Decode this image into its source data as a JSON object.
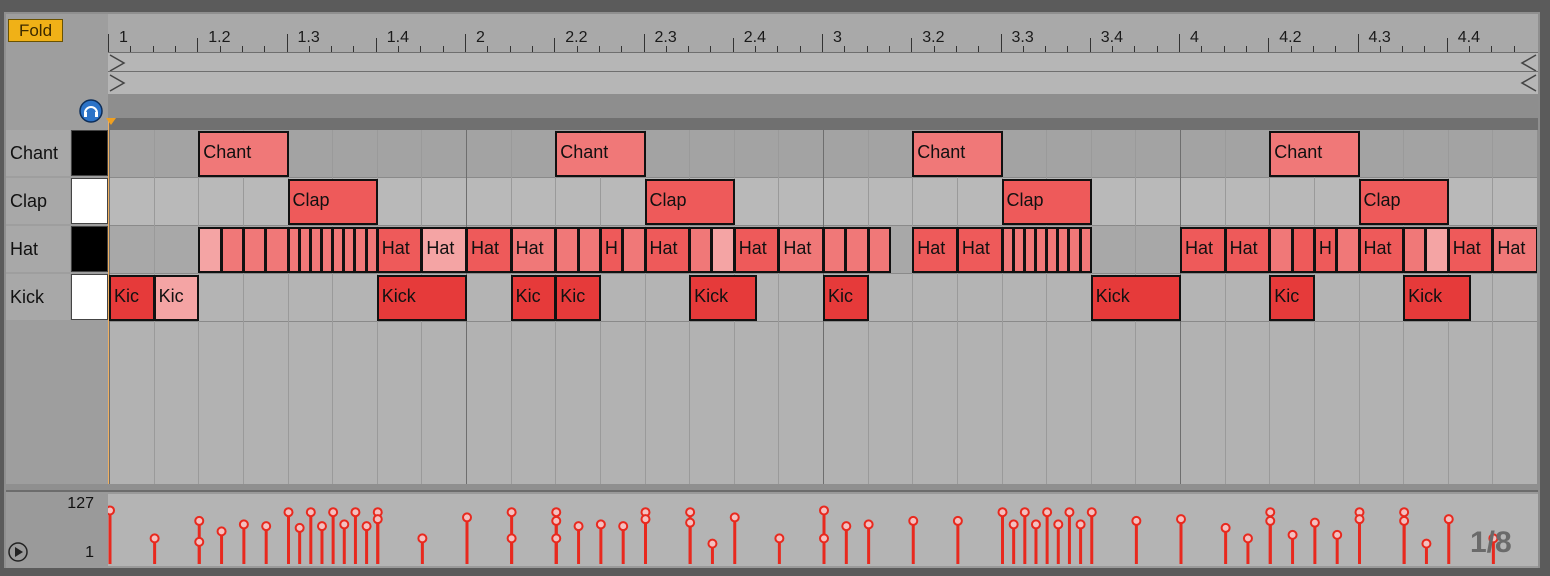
{
  "fold_label": "Fold",
  "ruler": {
    "labels": [
      "1",
      "1.2",
      "1.3",
      "1.4",
      "2",
      "2.2",
      "2.3",
      "2.4",
      "3",
      "3.2",
      "3.3",
      "3.4",
      "4",
      "4.2",
      "4.3",
      "4.4"
    ]
  },
  "lanes": [
    {
      "name": "Chant",
      "key": "black"
    },
    {
      "name": "Clap",
      "key": "white"
    },
    {
      "name": "Hat",
      "key": "black"
    },
    {
      "name": "Kick",
      "key": "white"
    }
  ],
  "notes": [
    {
      "lane": 0,
      "start": 0.5,
      "len": 0.5,
      "label": "Chant",
      "shade": "light"
    },
    {
      "lane": 0,
      "start": 2.5,
      "len": 0.5,
      "label": "Chant",
      "shade": "light"
    },
    {
      "lane": 0,
      "start": 4.5,
      "len": 0.5,
      "label": "Chant",
      "shade": "light"
    },
    {
      "lane": 0,
      "start": 6.5,
      "len": 0.5,
      "label": "Chant",
      "shade": "light"
    },
    {
      "lane": 1,
      "start": 1.0,
      "len": 0.5,
      "label": "Clap",
      "shade": "strong"
    },
    {
      "lane": 1,
      "start": 3.0,
      "len": 0.5,
      "label": "Clap",
      "shade": "strong"
    },
    {
      "lane": 1,
      "start": 5.0,
      "len": 0.5,
      "label": "Clap",
      "shade": "strong"
    },
    {
      "lane": 1,
      "start": 7.0,
      "len": 0.5,
      "label": "Clap",
      "shade": "strong"
    },
    {
      "lane": 2,
      "start": 0.5,
      "len": 0.125,
      "label": "",
      "shade": "pale"
    },
    {
      "lane": 2,
      "start": 0.625,
      "len": 0.125,
      "label": "",
      "shade": "light"
    },
    {
      "lane": 2,
      "start": 0.75,
      "len": 0.125,
      "label": "",
      "shade": "light"
    },
    {
      "lane": 2,
      "start": 0.875,
      "len": 0.125,
      "label": "",
      "shade": "light"
    },
    {
      "lane": 2,
      "start": 1.0,
      "len": 0.0625,
      "label": "",
      "shade": "light"
    },
    {
      "lane": 2,
      "start": 1.0625,
      "len": 0.0625,
      "label": "",
      "shade": "light"
    },
    {
      "lane": 2,
      "start": 1.125,
      "len": 0.0625,
      "label": "",
      "shade": "light"
    },
    {
      "lane": 2,
      "start": 1.1875,
      "len": 0.0625,
      "label": "",
      "shade": "light"
    },
    {
      "lane": 2,
      "start": 1.25,
      "len": 0.0625,
      "label": "",
      "shade": "light"
    },
    {
      "lane": 2,
      "start": 1.3125,
      "len": 0.0625,
      "label": "",
      "shade": "light"
    },
    {
      "lane": 2,
      "start": 1.375,
      "len": 0.0625,
      "label": "",
      "shade": "light"
    },
    {
      "lane": 2,
      "start": 1.4375,
      "len": 0.0625,
      "label": "",
      "shade": "light"
    },
    {
      "lane": 2,
      "start": 1.5,
      "len": 0.25,
      "label": "Hat",
      "shade": "strong"
    },
    {
      "lane": 2,
      "start": 1.75,
      "len": 0.25,
      "label": "Hat",
      "shade": "pale"
    },
    {
      "lane": 2,
      "start": 2.0,
      "len": 0.25,
      "label": "Hat",
      "shade": "strong"
    },
    {
      "lane": 2,
      "start": 2.25,
      "len": 0.25,
      "label": "Hat",
      "shade": "light"
    },
    {
      "lane": 2,
      "start": 2.5,
      "len": 0.125,
      "label": "",
      "shade": "light"
    },
    {
      "lane": 2,
      "start": 2.625,
      "len": 0.125,
      "label": "",
      "shade": "light"
    },
    {
      "lane": 2,
      "start": 2.75,
      "len": 0.125,
      "label": "H",
      "shade": "strong"
    },
    {
      "lane": 2,
      "start": 2.875,
      "len": 0.125,
      "label": "",
      "shade": "light"
    },
    {
      "lane": 2,
      "start": 3.0,
      "len": 0.25,
      "label": "Hat",
      "shade": "strong"
    },
    {
      "lane": 2,
      "start": 3.25,
      "len": 0.125,
      "label": "",
      "shade": "light"
    },
    {
      "lane": 2,
      "start": 3.375,
      "len": 0.125,
      "label": "",
      "shade": "pale"
    },
    {
      "lane": 2,
      "start": 3.5,
      "len": 0.25,
      "label": "Hat",
      "shade": "strong"
    },
    {
      "lane": 2,
      "start": 3.75,
      "len": 0.25,
      "label": "Hat",
      "shade": "light"
    },
    {
      "lane": 2,
      "start": 4.0,
      "len": 0.125,
      "label": "",
      "shade": "light"
    },
    {
      "lane": 2,
      "start": 4.125,
      "len": 0.125,
      "label": "",
      "shade": "light"
    },
    {
      "lane": 2,
      "start": 4.25,
      "len": 0.125,
      "label": "",
      "shade": "light"
    },
    {
      "lane": 2,
      "start": 4.5,
      "len": 0.25,
      "label": "Hat",
      "shade": "strong"
    },
    {
      "lane": 2,
      "start": 4.75,
      "len": 0.25,
      "label": "Hat",
      "shade": "strong"
    },
    {
      "lane": 2,
      "start": 5.0,
      "len": 0.0625,
      "label": "",
      "shade": "light"
    },
    {
      "lane": 2,
      "start": 5.0625,
      "len": 0.0625,
      "label": "",
      "shade": "light"
    },
    {
      "lane": 2,
      "start": 5.125,
      "len": 0.0625,
      "label": "",
      "shade": "light"
    },
    {
      "lane": 2,
      "start": 5.1875,
      "len": 0.0625,
      "label": "",
      "shade": "light"
    },
    {
      "lane": 2,
      "start": 5.25,
      "len": 0.0625,
      "label": "",
      "shade": "light"
    },
    {
      "lane": 2,
      "start": 5.3125,
      "len": 0.0625,
      "label": "",
      "shade": "light"
    },
    {
      "lane": 2,
      "start": 5.375,
      "len": 0.0625,
      "label": "",
      "shade": "light"
    },
    {
      "lane": 2,
      "start": 5.4375,
      "len": 0.0625,
      "label": "",
      "shade": "light"
    },
    {
      "lane": 2,
      "start": 6.0,
      "len": 0.25,
      "label": "Hat",
      "shade": "strong"
    },
    {
      "lane": 2,
      "start": 6.25,
      "len": 0.25,
      "label": "Hat",
      "shade": "strong"
    },
    {
      "lane": 2,
      "start": 6.5,
      "len": 0.125,
      "label": "",
      "shade": "light"
    },
    {
      "lane": 2,
      "start": 6.625,
      "len": 0.125,
      "label": "",
      "shade": "strong"
    },
    {
      "lane": 2,
      "start": 6.75,
      "len": 0.125,
      "label": "H",
      "shade": "strong"
    },
    {
      "lane": 2,
      "start": 6.875,
      "len": 0.125,
      "label": "",
      "shade": "light"
    },
    {
      "lane": 2,
      "start": 7.0,
      "len": 0.25,
      "label": "Hat",
      "shade": "strong"
    },
    {
      "lane": 2,
      "start": 7.25,
      "len": 0.125,
      "label": "",
      "shade": "light"
    },
    {
      "lane": 2,
      "start": 7.375,
      "len": 0.125,
      "label": "",
      "shade": "pale"
    },
    {
      "lane": 2,
      "start": 7.5,
      "len": 0.25,
      "label": "Hat",
      "shade": "strong"
    },
    {
      "lane": 2,
      "start": 7.75,
      "len": 0.25,
      "label": "Hat",
      "shade": "light"
    },
    {
      "lane": 3,
      "start": 0.0,
      "len": 0.25,
      "label": "Kic",
      "shade": "deep"
    },
    {
      "lane": 3,
      "start": 0.25,
      "len": 0.25,
      "label": "Kic",
      "shade": "pale"
    },
    {
      "lane": 3,
      "start": 1.5,
      "len": 0.5,
      "label": "Kick",
      "shade": "deep"
    },
    {
      "lane": 3,
      "start": 2.25,
      "len": 0.25,
      "label": "Kic",
      "shade": "deep"
    },
    {
      "lane": 3,
      "start": 2.5,
      "len": 0.25,
      "label": "Kic",
      "shade": "deep"
    },
    {
      "lane": 3,
      "start": 3.25,
      "len": 0.375,
      "label": "Kick",
      "shade": "deep"
    },
    {
      "lane": 3,
      "start": 4.0,
      "len": 0.25,
      "label": "Kic",
      "shade": "deep"
    },
    {
      "lane": 3,
      "start": 5.5,
      "len": 0.5,
      "label": "Kick",
      "shade": "deep"
    },
    {
      "lane": 3,
      "start": 6.5,
      "len": 0.25,
      "label": "Kic",
      "shade": "deep"
    },
    {
      "lane": 3,
      "start": 7.25,
      "len": 0.375,
      "label": "Kick",
      "shade": "deep"
    }
  ],
  "velocity": {
    "max_label": "127",
    "min_label": "1",
    "points": [
      {
        "t": 0.0,
        "v": 120
      },
      {
        "t": 0.25,
        "v": 40
      },
      {
        "t": 0.5,
        "v": 90
      },
      {
        "t": 0.5,
        "v": 30
      },
      {
        "t": 0.625,
        "v": 60
      },
      {
        "t": 0.75,
        "v": 80
      },
      {
        "t": 0.875,
        "v": 75
      },
      {
        "t": 1.0,
        "v": 115
      },
      {
        "t": 1.0625,
        "v": 70
      },
      {
        "t": 1.125,
        "v": 115
      },
      {
        "t": 1.1875,
        "v": 75
      },
      {
        "t": 1.25,
        "v": 115
      },
      {
        "t": 1.3125,
        "v": 80
      },
      {
        "t": 1.375,
        "v": 115
      },
      {
        "t": 1.4375,
        "v": 75
      },
      {
        "t": 1.5,
        "v": 115
      },
      {
        "t": 1.5,
        "v": 95
      },
      {
        "t": 1.75,
        "v": 40
      },
      {
        "t": 2.0,
        "v": 100
      },
      {
        "t": 2.25,
        "v": 115
      },
      {
        "t": 2.25,
        "v": 40
      },
      {
        "t": 2.5,
        "v": 115
      },
      {
        "t": 2.5,
        "v": 90
      },
      {
        "t": 2.5,
        "v": 40
      },
      {
        "t": 2.625,
        "v": 75
      },
      {
        "t": 2.75,
        "v": 80
      },
      {
        "t": 2.875,
        "v": 75
      },
      {
        "t": 3.0,
        "v": 115
      },
      {
        "t": 3.0,
        "v": 95
      },
      {
        "t": 3.25,
        "v": 115
      },
      {
        "t": 3.25,
        "v": 85
      },
      {
        "t": 3.375,
        "v": 25
      },
      {
        "t": 3.5,
        "v": 100
      },
      {
        "t": 3.75,
        "v": 40
      },
      {
        "t": 4.0,
        "v": 120
      },
      {
        "t": 4.0,
        "v": 40
      },
      {
        "t": 4.125,
        "v": 75
      },
      {
        "t": 4.25,
        "v": 80
      },
      {
        "t": 4.5,
        "v": 90
      },
      {
        "t": 4.75,
        "v": 90
      },
      {
        "t": 5.0,
        "v": 115
      },
      {
        "t": 5.0625,
        "v": 80
      },
      {
        "t": 5.125,
        "v": 115
      },
      {
        "t": 5.1875,
        "v": 80
      },
      {
        "t": 5.25,
        "v": 115
      },
      {
        "t": 5.3125,
        "v": 80
      },
      {
        "t": 5.375,
        "v": 115
      },
      {
        "t": 5.4375,
        "v": 80
      },
      {
        "t": 5.5,
        "v": 115
      },
      {
        "t": 5.75,
        "v": 90
      },
      {
        "t": 6.0,
        "v": 95
      },
      {
        "t": 6.25,
        "v": 70
      },
      {
        "t": 6.375,
        "v": 40
      },
      {
        "t": 6.5,
        "v": 115
      },
      {
        "t": 6.5,
        "v": 90
      },
      {
        "t": 6.625,
        "v": 50
      },
      {
        "t": 6.75,
        "v": 85
      },
      {
        "t": 6.875,
        "v": 50
      },
      {
        "t": 7.0,
        "v": 115
      },
      {
        "t": 7.0,
        "v": 95
      },
      {
        "t": 7.25,
        "v": 115
      },
      {
        "t": 7.25,
        "v": 90
      },
      {
        "t": 7.375,
        "v": 25
      },
      {
        "t": 7.5,
        "v": 95
      },
      {
        "t": 7.75,
        "v": 40
      }
    ]
  },
  "grid_readout": "1/8",
  "colors": {
    "note_pale": "#f4a4a4",
    "note_light": "#f07878",
    "note_strong": "#ee5a5a",
    "note_deep": "#e63a3a",
    "velocity": "#e8291e",
    "fold_button": "#f0b117"
  }
}
